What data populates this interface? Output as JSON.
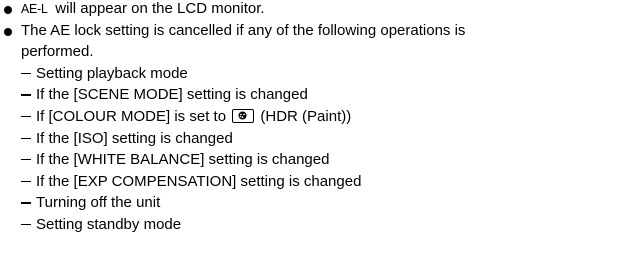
{
  "bullets": [
    {
      "indicator": "AE-L",
      "text": "will appear on the LCD monitor."
    },
    {
      "text_line1": "The AE lock setting is cancelled if any of the following operations is",
      "text_line2": "performed."
    }
  ],
  "cancel_operations": [
    "Setting playback mode",
    "If the [SCENE MODE] setting is changed",
    {
      "before_icon": "If [COLOUR MODE] is set to",
      "icon": "hdr-paint-icon",
      "after_icon": "(HDR (Paint))"
    },
    "If the [ISO] setting is changed",
    "If the [WHITE BALANCE] setting is changed",
    "If the [EXP COMPENSATION] setting is changed",
    "Turning off the unit",
    "Setting standby mode"
  ]
}
